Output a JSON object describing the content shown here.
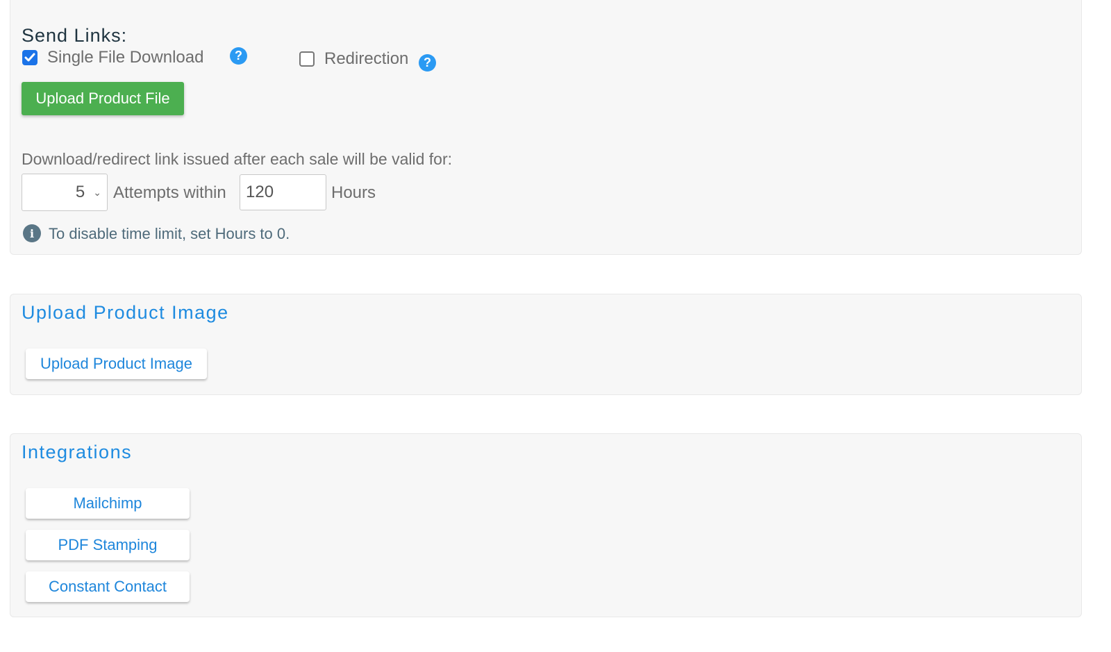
{
  "send_links": {
    "title": "Send Links:",
    "options": [
      {
        "label": "Single File Download",
        "checked": true,
        "help_icon": "question-circle-icon"
      },
      {
        "label": "Redirection",
        "checked": false,
        "help_icon": "question-circle-icon"
      }
    ],
    "upload_button": "Upload Product File",
    "validity_label": "Download/redirect link issued after each sale will be valid for:",
    "attempts_selected": "5",
    "attempts_label": "Attempts within",
    "hours_value": "120",
    "hours_label": "Hours",
    "info_icon": "info-circle-icon",
    "info_text": "To disable time limit, set Hours to 0."
  },
  "product_image": {
    "title": "Upload Product Image",
    "button": "Upload Product Image"
  },
  "integrations": {
    "title": "Integrations",
    "buttons": [
      "Mailchimp",
      "PDF Stamping",
      "Constant Contact"
    ]
  },
  "colors": {
    "accent_blue": "#1e8be0",
    "success_green": "#4caf50",
    "checkbox_blue": "#1b73e8",
    "help_blue": "#2b9af3",
    "panel_bg": "#f7f7f7"
  }
}
